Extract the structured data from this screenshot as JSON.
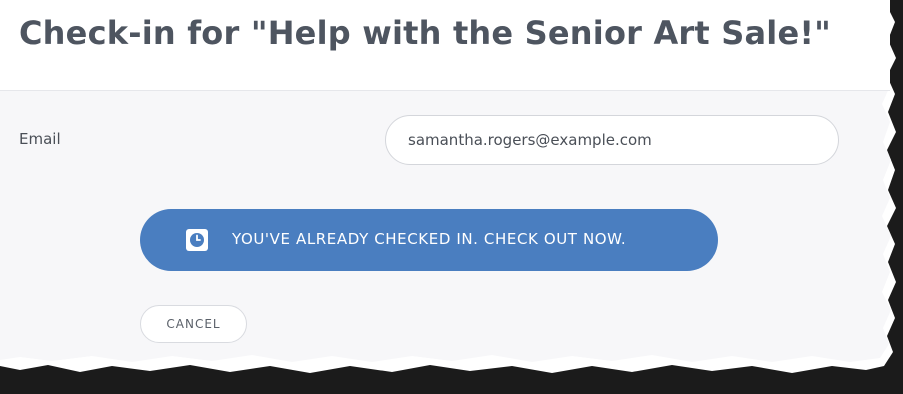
{
  "header": {
    "title": "Check-in for \"Help with the Senior Art Sale!\""
  },
  "form": {
    "email_label": "Email",
    "email_value": "samantha.rogers@example.com"
  },
  "actions": {
    "checkout_label": "YOU'VE ALREADY CHECKED IN. CHECK OUT NOW.",
    "checkout_icon": "clock-icon",
    "cancel_label": "CANCEL"
  },
  "colors": {
    "primary_button": "#4a7ec0",
    "title_text": "#4e5560",
    "body_background": "#f7f7f9"
  }
}
